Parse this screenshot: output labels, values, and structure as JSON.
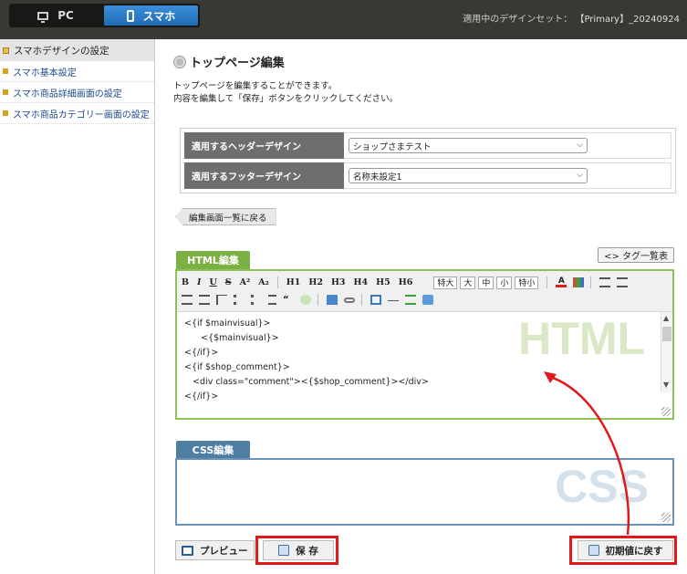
{
  "topbar": {
    "tabs": [
      {
        "label": "PC",
        "icon": "monitor-icon",
        "active": false
      },
      {
        "label": "スマホ",
        "icon": "smartphone-icon",
        "active": true
      }
    ],
    "design_set_label": "適用中のデザインセット：",
    "design_set_value": "【Primary】_20240924"
  },
  "sidebar": {
    "heading": "スマホデザインの設定",
    "items": [
      {
        "label": "スマホ基本設定"
      },
      {
        "label": "スマホ商品詳細画面の設定"
      },
      {
        "label": "スマホ商品カテゴリー画面の設定"
      }
    ]
  },
  "main": {
    "title": "トップページ編集",
    "desc_line1": "トップページを編集することができます。",
    "desc_line2": "内容を編集して「保存」ボタンをクリックしてください。",
    "header_design_label": "適用するヘッダーデザイン",
    "header_design_value": "ショップさまテスト",
    "footer_design_label": "適用するフッターデザイン",
    "footer_design_value": "名称未設定1",
    "back_label": "編集画面一覧に戻る",
    "tag_list_label": "<> タグ一覧表",
    "html_tab": "HTML編集",
    "css_tab": "CSS編集",
    "html_watermark": "HTML",
    "css_watermark": "CSS",
    "toolbar_row1": [
      "B",
      "I",
      "U",
      "S",
      "A²",
      "A₂",
      "H1",
      "H2",
      "H3",
      "H4",
      "H5",
      "H6"
    ],
    "size_buttons": [
      "特大",
      "大",
      "中",
      "小",
      "特小"
    ],
    "code_lines": [
      "<{if $mainvisual}>",
      "      <{$mainvisual}>",
      "<{/if}>",
      "",
      "<{if $shop_comment}>",
      "   <div class=\"comment\"><{$shop_comment}></div>",
      "<{/if}>"
    ],
    "preview_label": "プレビュー",
    "save_label": "保 存",
    "reset_label": "初期値に戻す"
  },
  "colors": {
    "accent_blue": "#1f6bb5",
    "html_green": "#7bb043",
    "css_blue": "#4f7ea3",
    "highlight_red": "#e01a1a"
  }
}
